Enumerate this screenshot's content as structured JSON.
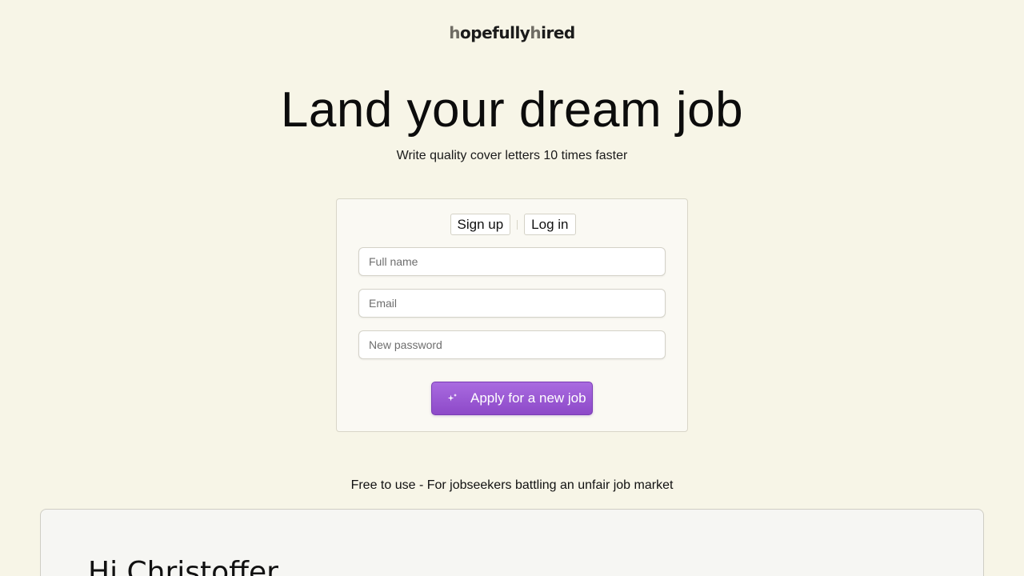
{
  "logo": {
    "part1": "h",
    "part2": "opefully",
    "part3": "h",
    "part4": "ired"
  },
  "hero": {
    "title": "Land your dream job",
    "subtitle": "Write quality cover letters 10 times faster"
  },
  "auth": {
    "tabs": {
      "signup": "Sign up",
      "login": "Log in"
    },
    "fields": {
      "full_name": {
        "placeholder": "Full name",
        "value": ""
      },
      "email": {
        "placeholder": "Email",
        "value": ""
      },
      "password": {
        "placeholder": "New password",
        "value": ""
      }
    },
    "submit_label": "Apply for a new job",
    "submit_icon": "sparkle-icon",
    "accent_color": "#9b5bd6"
  },
  "tagline": "Free to use - For jobseekers battling an unfair job market",
  "preview": {
    "greeting": "Hi Christoffer"
  }
}
